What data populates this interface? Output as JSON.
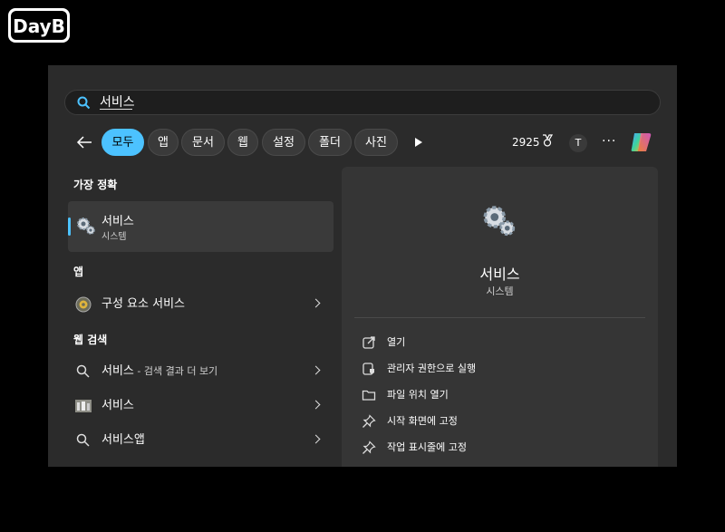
{
  "logo": {
    "text": "DayB"
  },
  "search": {
    "value": "서비스"
  },
  "filters": {
    "chips": [
      {
        "label": "모두",
        "active": true
      },
      {
        "label": "앱"
      },
      {
        "label": "문서"
      },
      {
        "label": "웹"
      },
      {
        "label": "설정"
      },
      {
        "label": "폴더"
      },
      {
        "label": "사진"
      }
    ]
  },
  "header": {
    "points": "2925",
    "avatar_initial": "T",
    "more": "···"
  },
  "results": {
    "best_match_heading": "가장 정확",
    "best_match": {
      "title": "서비스",
      "subtitle": "시스템"
    },
    "apps_heading": "앱",
    "apps": [
      {
        "label": "구성 요소 서비스"
      }
    ],
    "web_heading": "웹 검색",
    "web": [
      {
        "label": "서비스",
        "suffix": " - 검색 결과 더 보기"
      },
      {
        "label": "서비스"
      },
      {
        "label": "서비스앱"
      }
    ]
  },
  "preview": {
    "title": "서비스",
    "subtitle": "시스템",
    "actions": [
      {
        "label": "열기",
        "icon": "open-external-icon"
      },
      {
        "label": "관리자 권한으로 실행",
        "icon": "shield-icon"
      },
      {
        "label": "파일 위치 열기",
        "icon": "folder-icon"
      },
      {
        "label": "시작 화면에 고정",
        "icon": "pin-icon"
      },
      {
        "label": "작업 표시줄에 고정",
        "icon": "pin-icon"
      }
    ]
  },
  "colors": {
    "accent": "#4cc2ff",
    "window": "#2b2b2b",
    "panel": "#353535"
  }
}
